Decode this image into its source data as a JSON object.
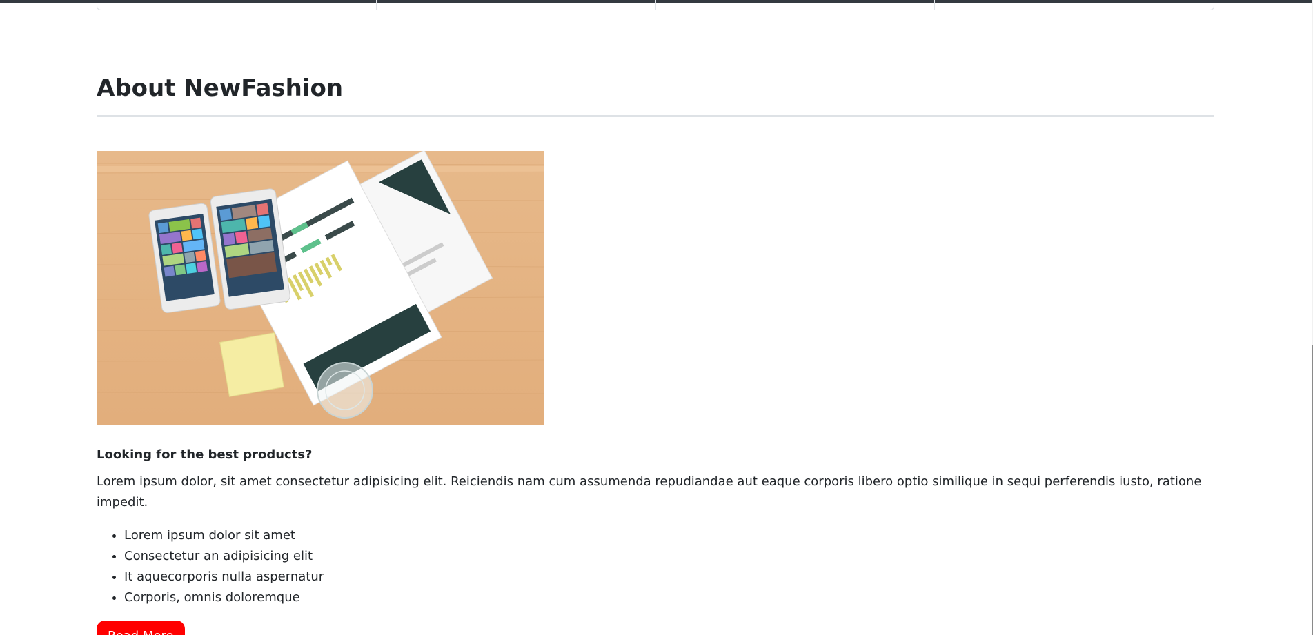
{
  "about": {
    "title": "About NewFashion",
    "image_alt": "Two phones, documents with charts, a sticky note pad and a glass on a wooden desk",
    "lead_heading": "Looking for the best products?",
    "body": "Lorem ipsum dolor, sit amet consectetur adipisicing elit. Reiciendis nam cum assumenda repudiandae aut eaque corporis libero optio similique in sequi perferendis iusto, ratione impedit.",
    "bullets": [
      "Lorem ipsum dolor sit amet",
      "Consectetur an adipisicing elit",
      "It aquecorporis nulla aspernatur",
      "Corporis, omnis doloremque"
    ],
    "button_label": "Read More"
  },
  "colors": {
    "accent": "#ff0000",
    "wood": "#e6b98c",
    "text": "#212529"
  }
}
